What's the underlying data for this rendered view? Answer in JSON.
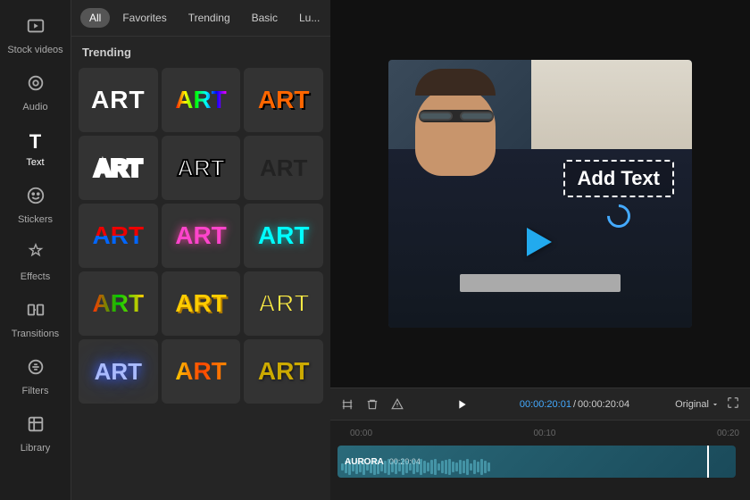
{
  "sidebar": {
    "items": [
      {
        "id": "stock-videos",
        "label": "Stock videos",
        "icon": "🎬"
      },
      {
        "id": "audio",
        "label": "Audio",
        "icon": "🎵"
      },
      {
        "id": "text",
        "label": "Text",
        "icon": "T",
        "active": true
      },
      {
        "id": "stickers",
        "label": "Stickers",
        "icon": "⭐"
      },
      {
        "id": "effects",
        "label": "Effects",
        "icon": "✨"
      },
      {
        "id": "transitions",
        "label": "Transitions",
        "icon": "⊠"
      },
      {
        "id": "filters",
        "label": "Filters",
        "icon": "🔧"
      },
      {
        "id": "library",
        "label": "Library",
        "icon": "📦"
      }
    ]
  },
  "filter_tabs": {
    "tabs": [
      {
        "id": "all",
        "label": "All",
        "active": true
      },
      {
        "id": "favorites",
        "label": "Favorites"
      },
      {
        "id": "trending",
        "label": "Trending"
      },
      {
        "id": "basic",
        "label": "Basic"
      },
      {
        "id": "lu",
        "label": "Lu..."
      }
    ],
    "more_icon": "▾"
  },
  "text_panel": {
    "section_label": "Trending",
    "styles": [
      {
        "id": 1,
        "label": "ART",
        "class": "art-plain"
      },
      {
        "id": 2,
        "label": "ART",
        "class": "art-rainbow"
      },
      {
        "id": 3,
        "label": "ART",
        "class": "art-orange"
      },
      {
        "id": 4,
        "label": "ART",
        "class": "art-white-outline"
      },
      {
        "id": 5,
        "label": "ART",
        "class": "art-black-outline"
      },
      {
        "id": 6,
        "label": "ART",
        "class": "art-black-bold"
      },
      {
        "id": 7,
        "label": "ART",
        "class": "art-red-blue"
      },
      {
        "id": 8,
        "label": "ART",
        "class": "art-pink"
      },
      {
        "id": 9,
        "label": "ART",
        "class": "art-cyan"
      },
      {
        "id": 10,
        "label": "ART",
        "class": "art-green-yellow"
      },
      {
        "id": 11,
        "label": "ART",
        "class": "art-gold"
      },
      {
        "id": 12,
        "label": "ART",
        "class": "art-yellow-outline"
      },
      {
        "id": 13,
        "label": "ART",
        "class": "art-white-glow"
      },
      {
        "id": 14,
        "label": "ART",
        "class": "art-yellow-red"
      },
      {
        "id": 15,
        "label": "ART",
        "class": "art-gold2"
      }
    ]
  },
  "preview": {
    "add_text_label": "Add Text",
    "quality_label": "Original",
    "time_current": "00:00:20:01",
    "time_total": "00:00:20:04"
  },
  "timeline": {
    "marks": [
      "00:00",
      "00:10",
      "00:20"
    ],
    "clip_label": "AURORA",
    "clip_time": "00:20:04"
  }
}
